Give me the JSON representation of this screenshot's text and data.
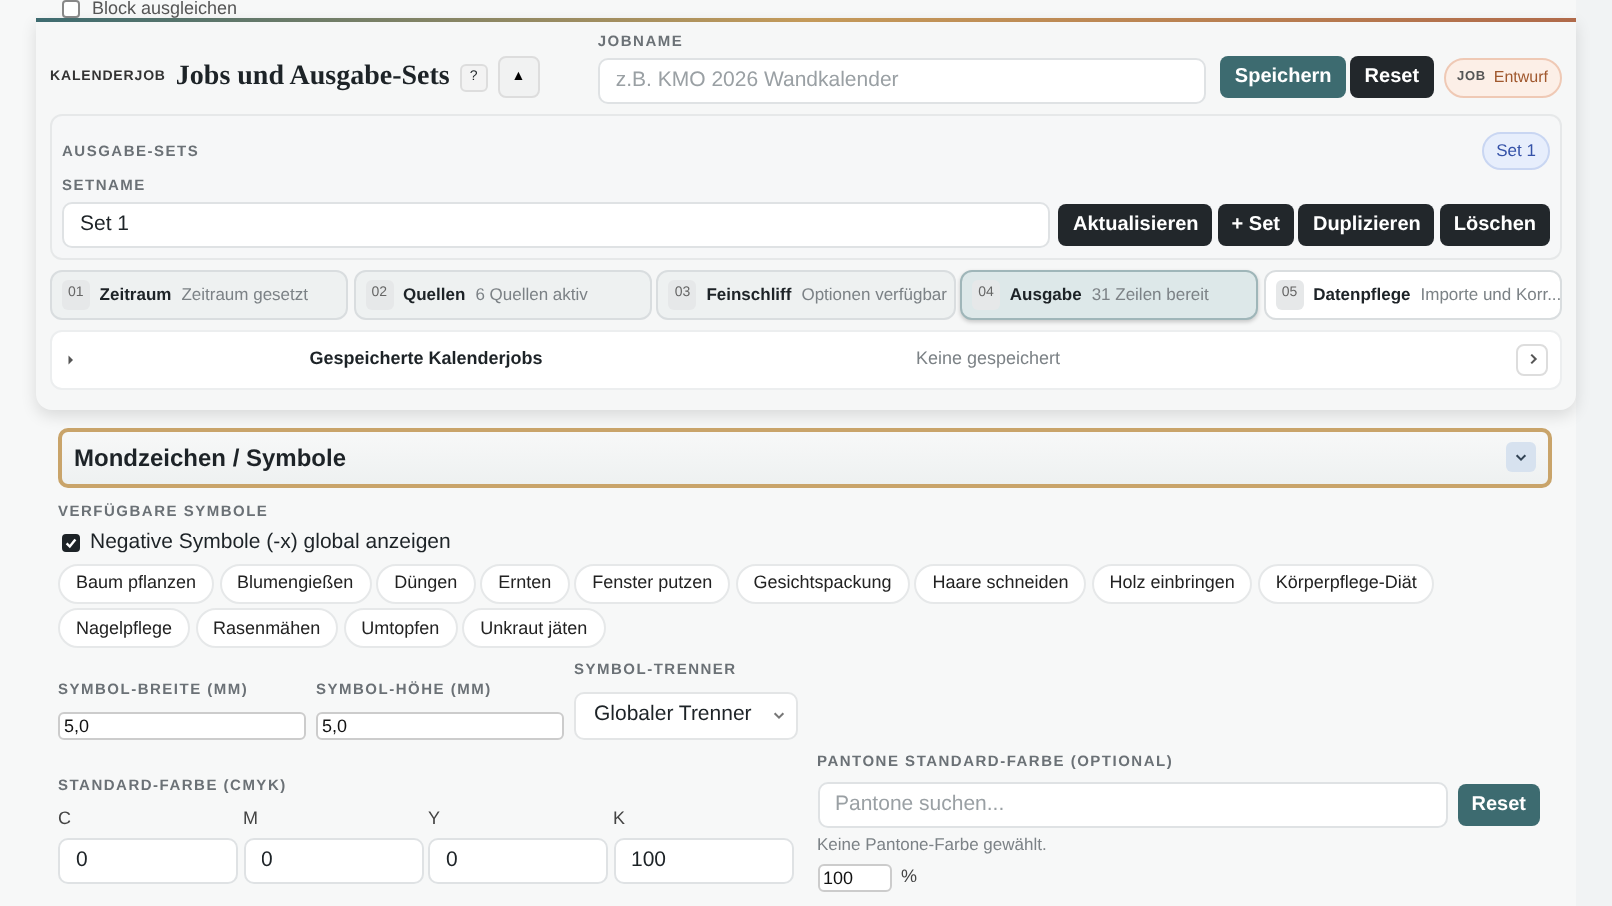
{
  "background_row": {
    "label": "Block ausgleichen",
    "checked": false
  },
  "header": {
    "eyebrow": "KALENDERJOB",
    "title": "Jobs und Ausgabe-Sets",
    "help": "?",
    "collapse": "▲"
  },
  "jobname": {
    "label": "JOBNAME",
    "placeholder": "z.B. KMO 2026 Wandkalender"
  },
  "job_buttons": [
    "Speichern",
    "Reset"
  ],
  "job_status": {
    "label": "JOB",
    "value": "Entwurf"
  },
  "sets": {
    "heading": "AUSGABE-SETS",
    "active": "Set 1",
    "name_label": "SETNAME",
    "name_value": "Set 1",
    "buttons": [
      "Aktualisieren",
      "+ Set",
      "Duplizieren",
      "Löschen"
    ]
  },
  "steps": [
    {
      "number": "01",
      "title": "Zeitraum",
      "status": "Zeitraum gesetzt",
      "selected": false
    },
    {
      "number": "02",
      "title": "Quellen",
      "status": "6 Quellen aktiv",
      "selected": false
    },
    {
      "number": "03",
      "title": "Feinschliff",
      "status": "Optionen verfügbar",
      "selected": false
    },
    {
      "number": "04",
      "title": "Ausgabe",
      "status": "31 Zeilen bereit",
      "selected": true
    },
    {
      "number": "05",
      "title": "Datenpflege",
      "status": "Importe und Korr...",
      "selected": false
    }
  ],
  "saved_jobs": {
    "title": "Gespeicherte Kalenderjobs",
    "status": "Keine gespeichert",
    "expanded": false
  },
  "section": {
    "title": "Mondzeichen / Symbole",
    "expanded": true
  },
  "symbols": {
    "label": "VERFÜGBARE SYMBOLE",
    "negative": {
      "label": "Negative Symbole (-x) global anzeigen",
      "checked": true
    },
    "chips": [
      "Baum pflanzen",
      "Blumengießen",
      "Düngen",
      "Ernten",
      "Fenster putzen",
      "Gesichtspackung",
      "Haare schneiden",
      "Holz einbringen",
      "Körperpflege-Diät",
      "Nagelpflege",
      "Rasenmähen",
      "Umtopfen",
      "Unkraut jäten"
    ]
  },
  "size_fields": [
    {
      "label": "SYMBOL-BREITE (MM)",
      "value": "5,0"
    },
    {
      "label": "SYMBOL-HÖHE (MM)",
      "value": "5,0"
    }
  ],
  "separator": {
    "label": "SYMBOL-TRENNER",
    "value": "Globaler Trenner"
  },
  "cmyk": {
    "label": "STANDARD-FARBE (CMYK)",
    "channels": [
      {
        "name": "C",
        "value": "0"
      },
      {
        "name": "M",
        "value": "0"
      },
      {
        "name": "Y",
        "value": "0"
      },
      {
        "name": "K",
        "value": "100"
      }
    ]
  },
  "pantone": {
    "label": "PANTONE STANDARD-FARBE (OPTIONAL)",
    "placeholder": "Pantone suchen...",
    "button": "Reset",
    "note": "Keine Pantone-Farbe gewählt.",
    "percent": "100",
    "unit": "%"
  }
}
